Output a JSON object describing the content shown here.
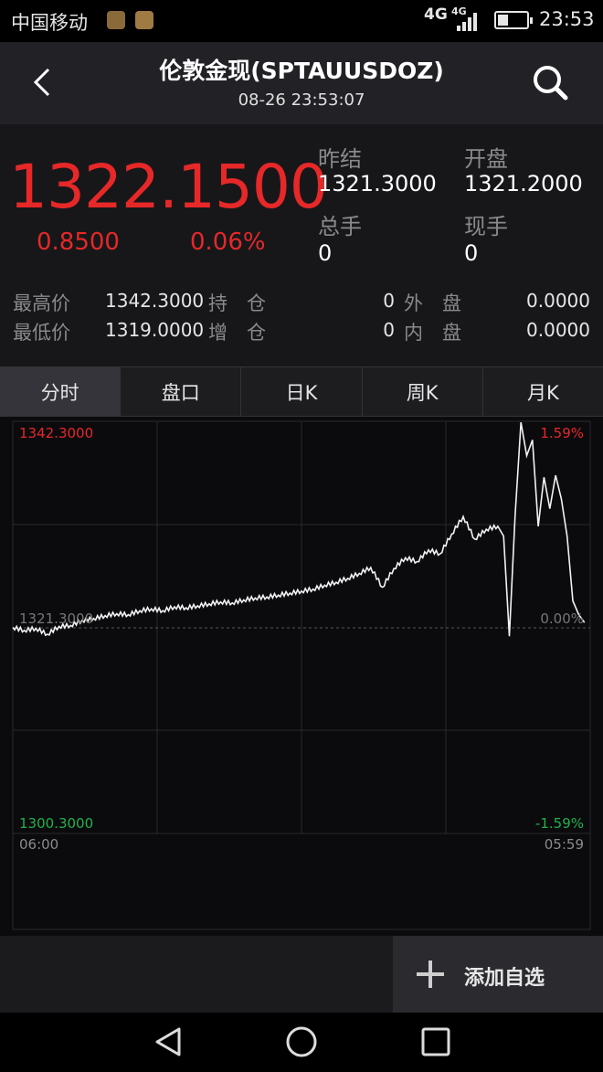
{
  "status_bar": {
    "carrier": "中国移动",
    "network_1": "4G",
    "network_2": "4G",
    "time": "23:53",
    "battery_level": 0.35
  },
  "header": {
    "title": "伦敦金现(SPTAUUSDOZ)",
    "timestamp": "08-26 23:53:07",
    "back_icon": "chevron-left-icon",
    "search_icon": "search-icon"
  },
  "quote": {
    "price": "1322.1500",
    "change": "0.8500",
    "change_pct": "0.06%",
    "prev_settle_label": "昨结",
    "prev_settle": "1321.3000",
    "open_label": "开盘",
    "open": "1321.2000",
    "total_vol_label": "总手",
    "total_vol": "0",
    "cur_vol_label": "现手",
    "cur_vol": "0",
    "high_label": "最高价",
    "high": "1342.3000",
    "low_label": "最低价",
    "low": "1319.0000",
    "hold_label": "持　仓",
    "hold": "0",
    "add_label": "增　仓",
    "add": "0",
    "outer_label": "外　盘",
    "outer": "0.0000",
    "inner_label": "内　盘",
    "inner": "0.0000",
    "up_color": "#e62828",
    "down_color": "#22b04a"
  },
  "tabs": [
    {
      "label": "分时",
      "active": true
    },
    {
      "label": "盘口",
      "active": false
    },
    {
      "label": "日K",
      "active": false
    },
    {
      "label": "周K",
      "active": false
    },
    {
      "label": "月K",
      "active": false
    }
  ],
  "chart_data": {
    "type": "line",
    "y_max_label": "1342.3000",
    "y_mid_label": "1321.3000",
    "y_min_label": "1300.3000",
    "pct_max_label": "1.59%",
    "pct_mid_label": "0.00%",
    "pct_min_label": "-1.59%",
    "x_start_label": "06:00",
    "x_end_label": "05:59",
    "ylim": [
      1300.3,
      1342.3
    ],
    "xlim": [
      0,
      100
    ],
    "grid": true,
    "series": [
      {
        "x": [
          0,
          2,
          4,
          6,
          8,
          10,
          12,
          14,
          16,
          18,
          20,
          22,
          24,
          26,
          28,
          30,
          32,
          34,
          36,
          38,
          40,
          42,
          44,
          46,
          48,
          50,
          52,
          54,
          56,
          58,
          60,
          62,
          64,
          66,
          68,
          70,
          72,
          74,
          76,
          78,
          80,
          82,
          84,
          85,
          86,
          87,
          88,
          89,
          90,
          91,
          92,
          93,
          94,
          95,
          96,
          97,
          98,
          99
        ],
        "values": [
          1321.3,
          1321.0,
          1321.2,
          1320.6,
          1321.4,
          1321.5,
          1322.0,
          1322.2,
          1322.5,
          1322.7,
          1322.6,
          1323.0,
          1323.2,
          1323.0,
          1323.4,
          1323.3,
          1323.5,
          1323.7,
          1323.9,
          1323.8,
          1324.1,
          1324.3,
          1324.4,
          1324.6,
          1324.8,
          1325.0,
          1325.2,
          1325.6,
          1325.9,
          1326.3,
          1326.8,
          1327.4,
          1325.4,
          1327.3,
          1328.4,
          1328.0,
          1329.2,
          1328.8,
          1330.8,
          1332.6,
          1330.3,
          1331.3,
          1331.6,
          1330.6,
          1320.4,
          1332.7,
          1342.2,
          1338.8,
          1340.4,
          1331.6,
          1336.6,
          1333.4,
          1336.8,
          1334.4,
          1330.6,
          1324.0,
          1322.6,
          1321.8
        ]
      }
    ]
  },
  "bottom": {
    "add_label": "添加自选",
    "add_icon": "plus-icon"
  },
  "navbar": {
    "back_icon": "triangle-back-icon",
    "home_icon": "circle-home-icon",
    "recent_icon": "square-recent-icon"
  }
}
